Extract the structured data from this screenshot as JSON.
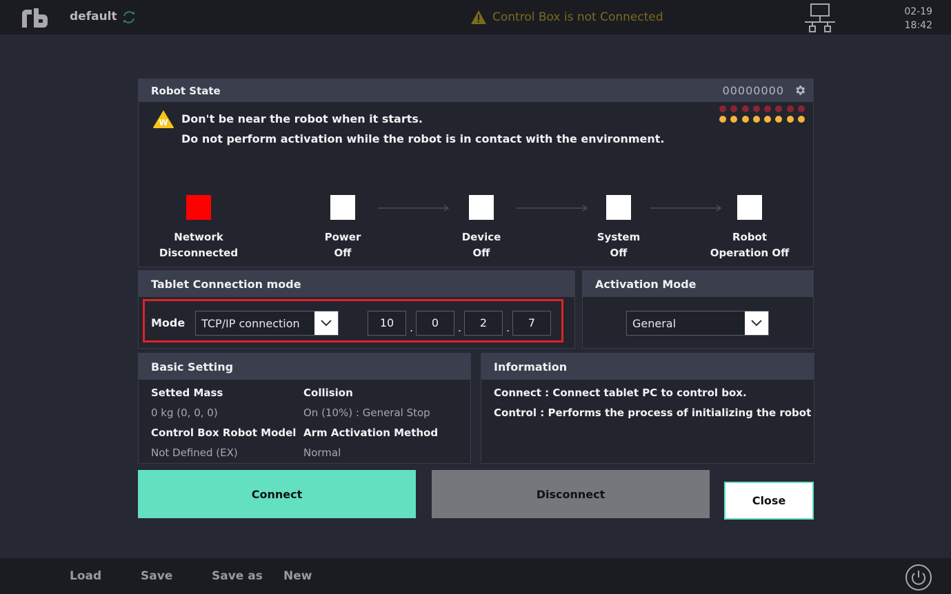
{
  "topbar": {
    "logo_icon": "rb-logo-icon",
    "project_name": "default",
    "sync_icon": "sync-icon",
    "warning_icon": "warning-triangle-icon",
    "status_message": "Control Box is not Connected",
    "status_color": "#7a6a1c",
    "network_icon": "network-icon",
    "date": "02-19",
    "time": "18:42"
  },
  "robot_state": {
    "title": "Robot State",
    "serial": "00000000",
    "settings_icon": "gear-icon",
    "warning_icon_letter": "W",
    "warning_lines": [
      "Don't be near the robot when it starts.",
      "Do not perform activation while the robot is in contact with the environment."
    ],
    "led_rows": [
      {
        "color": "#8a2433",
        "count": 8
      },
      {
        "color": "#f5b43c",
        "count": 8
      }
    ],
    "steps": [
      {
        "line1": "Network",
        "line2": "Disconnected",
        "status_color": "#ff0000"
      },
      {
        "line1": "Power",
        "line2": "Off",
        "status_color": "#ffffff"
      },
      {
        "line1": "Device",
        "line2": "Off",
        "status_color": "#ffffff"
      },
      {
        "line1": "System",
        "line2": "Off",
        "status_color": "#ffffff"
      },
      {
        "line1": "Robot",
        "line2": "Operation Off",
        "status_color": "#ffffff"
      }
    ]
  },
  "tablet_connection": {
    "title": "Tablet Connection mode",
    "mode_label": "Mode",
    "mode_value": "TCP/IP connection",
    "ip": [
      "10",
      "0",
      "2",
      "7"
    ],
    "ip_separator": "."
  },
  "activation_mode": {
    "title": "Activation Mode",
    "value": "General"
  },
  "basic_setting": {
    "title": "Basic Setting",
    "items": [
      {
        "key": "Setted Mass",
        "value": "0 kg (0, 0, 0)"
      },
      {
        "key": "Collision",
        "value": "On (10%) : General Stop"
      },
      {
        "key": "Control Box Robot Model",
        "value": "Not Defined (EX)"
      },
      {
        "key": "Arm Activation Method",
        "value": "Normal"
      }
    ]
  },
  "information": {
    "title": "Information",
    "lines": [
      "Connect : Connect tablet PC to control box.",
      "Control : Performs the process of initializing the robot"
    ]
  },
  "actions": {
    "connect": "Connect",
    "disconnect": "Disconnect",
    "close": "Close",
    "connect_color": "#62e0c0",
    "disconnect_color": "#76777c"
  },
  "bottombar": {
    "menu": [
      "Load",
      "Save",
      "Save as",
      "New"
    ],
    "power_icon": "power-icon"
  }
}
